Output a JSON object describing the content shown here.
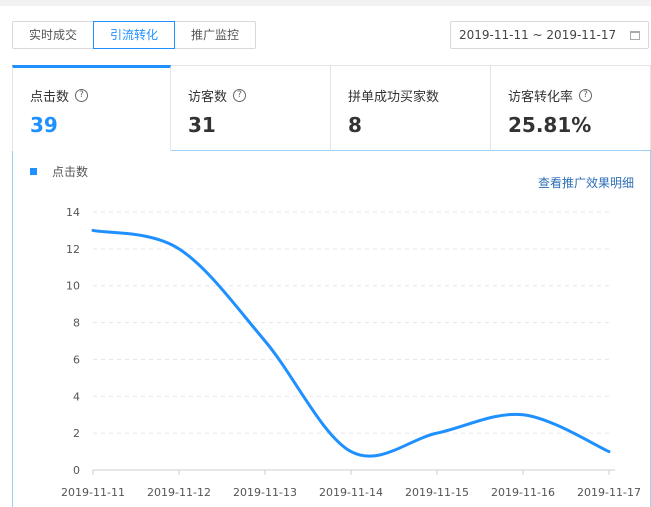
{
  "tabs": [
    "实时成交",
    "引流转化",
    "推广监控"
  ],
  "active_tab": 1,
  "date_range": "2019-11-11 ~ 2019-11-17",
  "metrics": [
    {
      "label": "点击数",
      "value": "39"
    },
    {
      "label": "访客数",
      "value": "31"
    },
    {
      "label": "拼单成功买家数",
      "value": "8"
    },
    {
      "label": "访客转化率",
      "value": "25.81%"
    }
  ],
  "help_symbol": "?",
  "detail_link": "查看推广效果明细",
  "colors": {
    "accent": "#1e90ff",
    "link": "#2d6fb6"
  },
  "chart_data": {
    "type": "line",
    "x": [
      "2019-11-11",
      "2019-11-12",
      "2019-11-13",
      "2019-11-14",
      "2019-11-15",
      "2019-11-16",
      "2019-11-17"
    ],
    "series": [
      {
        "name": "点击数",
        "values": [
          13,
          12,
          7,
          1,
          2,
          3,
          1
        ]
      }
    ],
    "ylim": [
      0,
      14
    ],
    "yticks": [
      0,
      2,
      4,
      6,
      8,
      10,
      12,
      14
    ],
    "smooth": true,
    "grid": true,
    "legend": "top-left"
  }
}
